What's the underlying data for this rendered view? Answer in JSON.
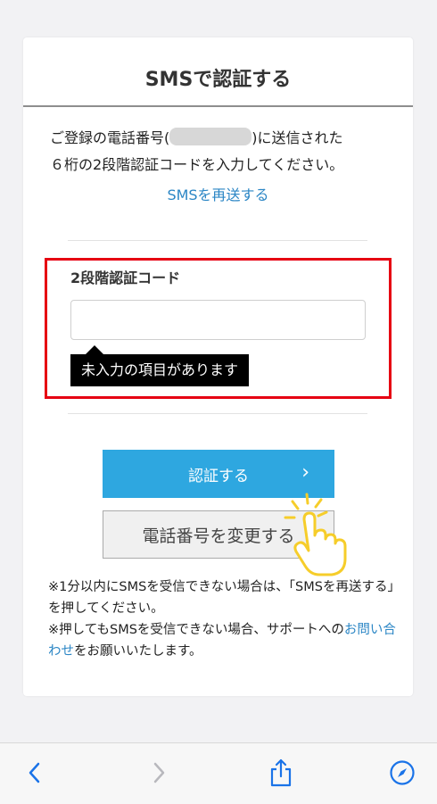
{
  "card": {
    "title": "SMSで認証する",
    "intro_line1_pre": "ご登録の電話番号(",
    "intro_line1_post": ")に送信された",
    "intro_line2": "６桁の2段階認証コードを入力してください。",
    "resend_link": "SMSを再送する"
  },
  "form": {
    "code_label": "2段階認証コード",
    "code_value": "",
    "error_tooltip": "未入力の項目があります"
  },
  "buttons": {
    "verify_label": "認証する",
    "change_phone_label": "電話番号を変更する"
  },
  "notes": {
    "note1": "※1分以内にSMSを受信できない場合は、「SMSを再送する」を押してください。",
    "note2_pre": "※押してもSMSを受信できない場合、サポートへの",
    "note2_link": "お問い合わせ",
    "note2_post": "をお願いいたします。"
  },
  "colors": {
    "accent": "#2ea7e0",
    "link": "#2b86c5",
    "highlight": "#e60012",
    "ios_blue": "#1a73e8"
  },
  "toolbar": {
    "icons": [
      "back-icon",
      "forward-icon",
      "share-icon",
      "compass-icon"
    ]
  }
}
